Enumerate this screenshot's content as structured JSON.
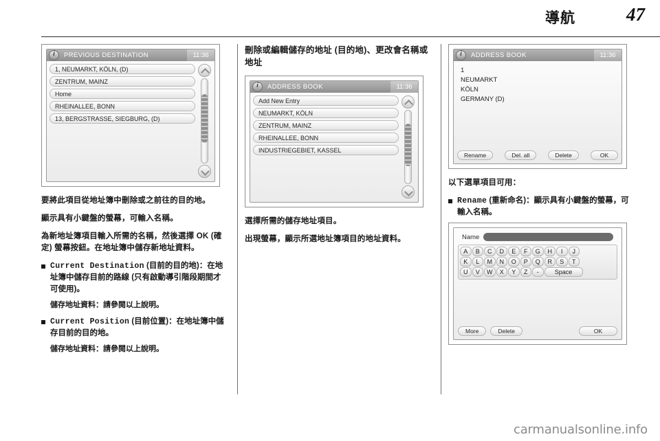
{
  "header": {
    "title": "導航",
    "page_number": "47"
  },
  "columns": {
    "left": {
      "para_1": "要將此項目從地址簿中刪除或之前往的目的地。",
      "para_2": "顯示具有小鍵盤的螢幕，可輸入名稱。",
      "para_3": "為新地址簿項目輸入所需的名稱，然後選擇 OK (確定) 螢幕按鈕。在地址簿中儲存新地址資料。",
      "bullet_1_term": "Current Destination",
      "bullet_1_cn": "(目前的目的地)",
      "bullet_1_text": "：在地址簿中儲存目前的路線 (只有啟動導引階段期間才可使用)。",
      "bullet_1_note": "儲存地址資料：請參閱以上說明。",
      "bullet_2_term": "Current Position",
      "bullet_2_cn": "(目前位置)",
      "bullet_2_text": "：在地址簿中儲存目前的目的地。",
      "bullet_2_note": "儲存地址資料：請參閱以上說明。"
    },
    "mid": {
      "heading": "刪除或編輯儲存的地址 (目的地)、更改會名稱或地址",
      "para_1": "選擇所需的儲存地址項目。",
      "para_2": "出現螢幕，顯示所選地址簿項目的地址資料。"
    },
    "right": {
      "para_1": "以下選單項目可用：",
      "bullet_1_term": "Rename",
      "bullet_1_cn": "(重新命名)",
      "bullet_1_text": "：顯示具有小鍵盤的螢幕，可輸入名稱。"
    }
  },
  "screens": {
    "previous_destination": {
      "info_icon": "info-icon",
      "title": "PREVIOUS DESTINATION",
      "clock": "11:36",
      "rows": [
        "1, NEUMARKT, KÖLN, (D)",
        "ZENTRUM, MAINZ",
        "Home",
        "RHEINALLEE, BONN",
        "13, BERGSTRASSE, SIEGBURG, (D)"
      ],
      "scroll_up_icon": "chevron-up-icon",
      "scroll_down_icon": "chevron-down-icon"
    },
    "address_book_list": {
      "info_icon": "info-icon",
      "title": "ADDRESS BOOK",
      "clock": "11:36",
      "rows": [
        "Add New Entry",
        "NEUMARKT, KÖLN",
        "ZENTRUM, MAINZ",
        "RHEINALLEE, BONN",
        "INDUSTRIEGEBIET, KASSEL"
      ],
      "scroll_up_icon": "chevron-up-icon",
      "scroll_down_icon": "chevron-down-icon"
    },
    "address_book_detail": {
      "info_icon": "info-icon",
      "title": "ADDRESS BOOK",
      "clock": "11:36",
      "detail_lines": [
        "1",
        "NEUMARKT",
        "KÖLN",
        "GERMANY (D)"
      ],
      "buttons": [
        "Rename",
        "Del. all",
        "Delete",
        "OK"
      ]
    },
    "keyboard": {
      "name_label": "Name",
      "name_value": "",
      "keys_row_1": [
        "A",
        "B",
        "C",
        "D",
        "E",
        "F",
        "G",
        "H",
        "I",
        "J"
      ],
      "keys_row_2": [
        "K",
        "L",
        "M",
        "N",
        "O",
        "P",
        "Q",
        "R",
        "S",
        "T"
      ],
      "keys_row_3": [
        "U",
        "V",
        "W",
        "X",
        "Y",
        "Z",
        "-"
      ],
      "space_key": "Space",
      "buttons": [
        "More",
        "Delete",
        "OK"
      ]
    }
  },
  "watermark": "carmanualsonline.info"
}
